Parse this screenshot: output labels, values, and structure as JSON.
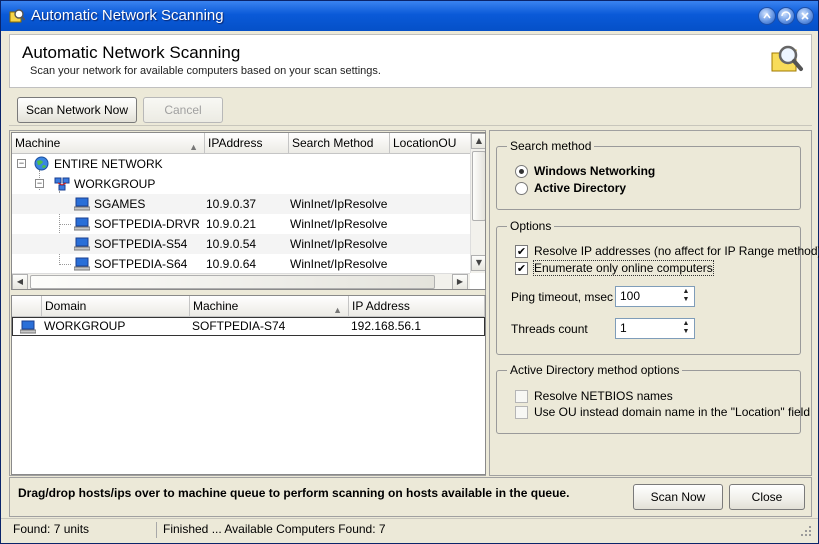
{
  "window": {
    "title": "Automatic Network Scanning"
  },
  "header": {
    "title": "Automatic Network Scanning",
    "subtitle": "Scan your network for available computers based on your scan settings."
  },
  "toolbar": {
    "scan_button": "Scan Network Now",
    "cancel_button": "Cancel"
  },
  "tree_grid": {
    "columns": [
      "Machine",
      "IPAddress",
      "Search Method",
      "LocationOU"
    ],
    "root": "ENTIRE NETWORK",
    "workgroup": "WORKGROUP",
    "rows": [
      {
        "machine": "SGAMES",
        "ip": "10.9.0.37",
        "method": "WinInet/IpResolve"
      },
      {
        "machine": "SOFTPEDIA-DRVR",
        "ip": "10.9.0.21",
        "method": "WinInet/IpResolve"
      },
      {
        "machine": "SOFTPEDIA-S54",
        "ip": "10.9.0.54",
        "method": "WinInet/IpResolve"
      },
      {
        "machine": "SOFTPEDIA-S64",
        "ip": "10.9.0.64",
        "method": "WinInet/IpResolve"
      }
    ]
  },
  "queue_grid": {
    "columns": [
      "Domain",
      "Machine",
      "IP Address"
    ],
    "rows": [
      {
        "domain": "WORKGROUP",
        "machine": "SOFTPEDIA-S74",
        "ip": "192.168.56.1"
      }
    ]
  },
  "search_method": {
    "title": "Search method",
    "options": [
      {
        "label": "Windows Networking",
        "selected": true
      },
      {
        "label": "Active Directory",
        "selected": false
      }
    ]
  },
  "options": {
    "title": "Options",
    "resolve_ip": "Resolve IP addresses (no affect for IP Range method)",
    "enumerate_online": "Enumerate only online computers",
    "ping_timeout_label": "Ping timeout, msec",
    "ping_timeout_value": "100",
    "threads_label": "Threads count",
    "threads_value": "1"
  },
  "ad_options": {
    "title": "Active Directory method options",
    "resolve_netbios": "Resolve NETBIOS names",
    "use_ou": "Use OU instead domain name in the \"Location\" field"
  },
  "footer": {
    "hint": "Drag/drop hosts/ips over to machine queue to perform scanning on hosts available in the queue.",
    "scan_now": "Scan Now",
    "close": "Close"
  },
  "status": {
    "found": "Found: 7 units",
    "message": "Finished ... Available Computers Found: 7"
  },
  "colors": {
    "titlebar": "#0a5ad8",
    "window_bg": "#ece9d8"
  }
}
